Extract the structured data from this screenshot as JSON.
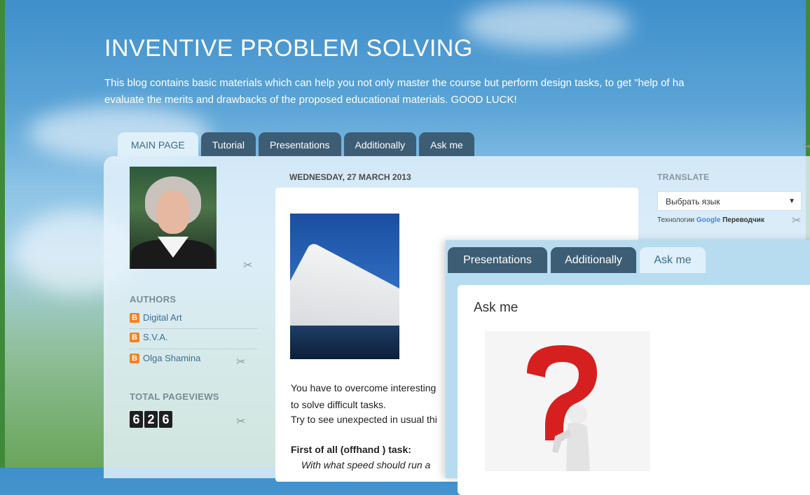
{
  "blog": {
    "title": "INVENTIVE PROBLEM SOLVING",
    "description_line1": "This blog contains basic materials which can help you not only master the course but perform design tasks, to get \"help of ha",
    "description_line2": "evaluate the merits and drawbacks of the proposed educational materials. GOOD LUCK!"
  },
  "tabs": [
    {
      "label": "MAIN PAGE",
      "active": true
    },
    {
      "label": "Tutorial"
    },
    {
      "label": "Presentations"
    },
    {
      "label": "Additionally"
    },
    {
      "label": "Ask me"
    }
  ],
  "sidebar": {
    "authors_heading": "AUTHORS",
    "authors": [
      "Digital Art",
      "S.V.A.",
      "Olga Shamina"
    ],
    "pageviews_heading": "TOTAL PAGEVIEWS",
    "pageviews_digits": [
      "6",
      "2",
      "6"
    ]
  },
  "post": {
    "date": "WEDNESDAY, 27 MARCH 2013",
    "line1": "You have to overcome interesting",
    "line2": " to solve difficult tasks.",
    "line3": "Try to see unexpected in usual thi",
    "task_heading": "First of all (offhand ) task:",
    "task_line": "With what speed should run a"
  },
  "translate": {
    "heading": "TRANSLATE",
    "select_value": "Выбрать язык",
    "powered_prefix": "Технологии",
    "powered_brand": "Google",
    "powered_suffix": "Переводчик"
  },
  "overlay": {
    "tabs": [
      {
        "label": "Presentations"
      },
      {
        "label": "Additionally"
      },
      {
        "label": "Ask me",
        "active": true
      }
    ],
    "title": "Ask me"
  },
  "colors": {
    "tab_dark": "#3d5d74",
    "tab_active": "#dff0fa",
    "link": "#3d6e93",
    "blogger_orange": "#f58220"
  },
  "icons": [
    "wrench-icon",
    "blogger-icon",
    "dropdown-arrow-icon",
    "question-mark-figure-image"
  ]
}
